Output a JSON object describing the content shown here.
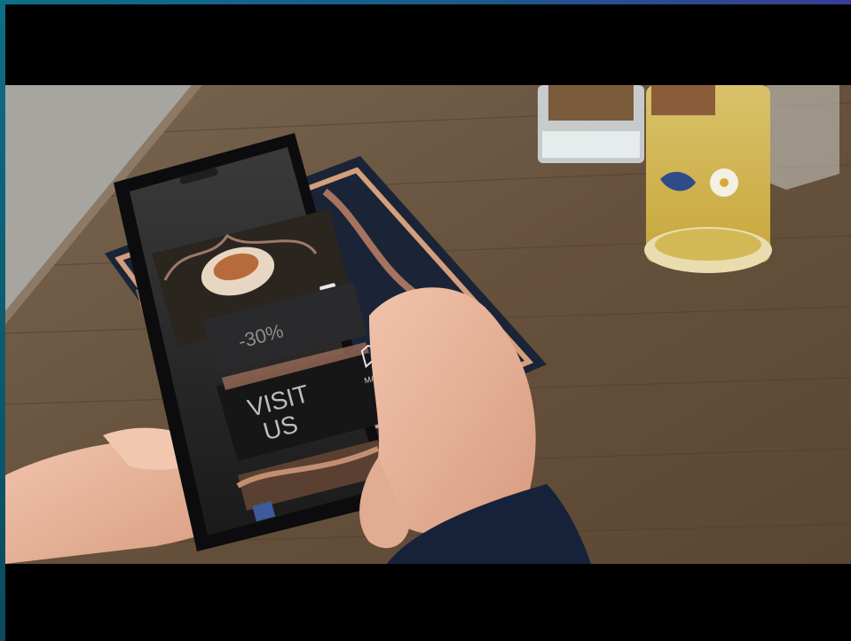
{
  "screen": {
    "discount_text": "-30%",
    "visit_title": "VISIT\nUS",
    "map_label": "MAPS"
  },
  "colors": {
    "table": "#6b5640",
    "pavement": "#a7a5a0",
    "beer": "#d9bf55",
    "phone": "#0c0c0e",
    "skin": "#e7b49a",
    "sleeve": "#16223a"
  }
}
